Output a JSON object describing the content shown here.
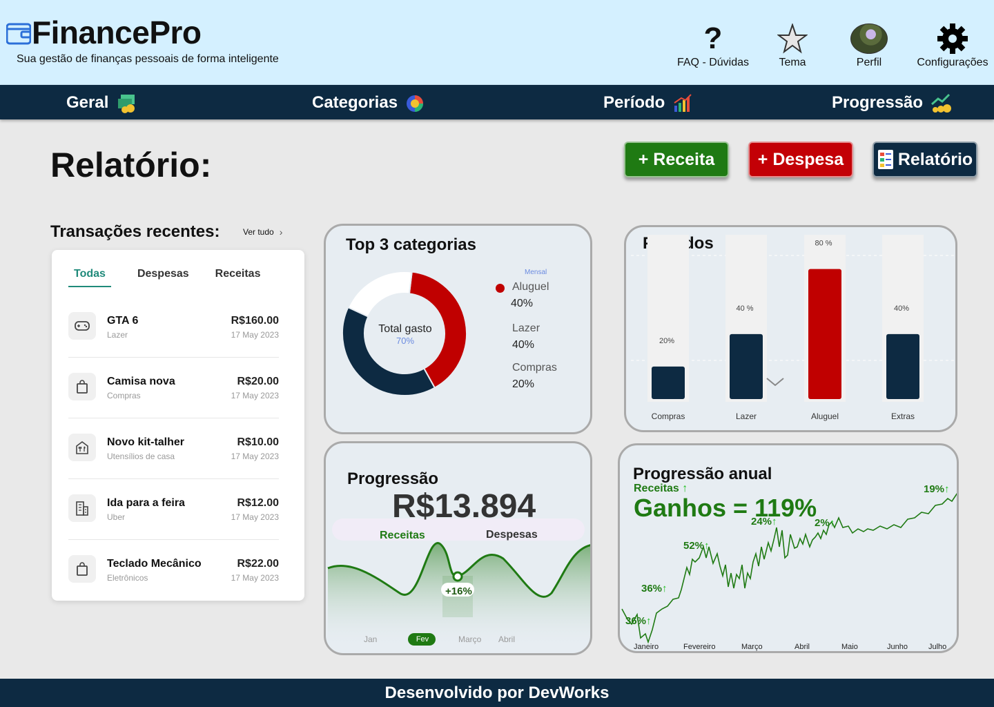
{
  "app": {
    "title": "FinancePro",
    "subtitle": "Sua gestão de finanças pessoais de forma inteligente"
  },
  "header_menu": {
    "faq": "FAQ - Dúvidas",
    "theme": "Tema",
    "profile": "Perfil",
    "settings": "Configurações"
  },
  "nav": {
    "general": "Geral",
    "categories": "Categorias",
    "period": "Período",
    "progression": "Progressão"
  },
  "page": {
    "title": "Relatório:"
  },
  "actions": {
    "income": "+ Receita",
    "expense": "+ Despesa",
    "report": "Relatório"
  },
  "transactions": {
    "title": "Transações recentes:",
    "see_all": "Ver tudo",
    "tabs": [
      "Todas",
      "Despesas",
      "Receitas"
    ],
    "items": [
      {
        "name": "GTA 6",
        "category": "Lazer",
        "amount": "R$160.00",
        "date": "17 May 2023",
        "icon": "gamepad-icon"
      },
      {
        "name": "Camisa nova",
        "category": "Compras",
        "amount": "R$20.00",
        "date": "17 May 2023",
        "icon": "shopping-bag-icon"
      },
      {
        "name": "Novo kit-talher",
        "category": "Utensílios de casa",
        "amount": "R$10.00",
        "date": "17 May 2023",
        "icon": "cutlery-icon"
      },
      {
        "name": "Ida para a feira",
        "category": "Uber",
        "amount": "R$12.00",
        "date": "17 May 2023",
        "icon": "building-icon"
      },
      {
        "name": "Teclado Mecânico",
        "category": "Eletrônicos",
        "amount": "R$22.00",
        "date": "17 May 2023",
        "icon": "shopping-bag-icon"
      }
    ]
  },
  "top_categories": {
    "title": "Top 3 categorias",
    "center_label": "Total gasto",
    "center_value": "70%",
    "period_label": "Mensal",
    "legend": [
      {
        "name": "Aluguel",
        "value": "40%"
      },
      {
        "name": "Lazer",
        "value": "40%"
      },
      {
        "name": "Compras",
        "value": "20%"
      }
    ],
    "colors": {
      "red": "#c00000",
      "dark": "#0d2a42",
      "white": "#ffffff"
    }
  },
  "chart_data": [
    {
      "type": "pie",
      "title": "Top 3 categorias",
      "categories": [
        "Aluguel",
        "Lazer",
        "Compras"
      ],
      "values": [
        40,
        40,
        20
      ]
    },
    {
      "type": "bar",
      "title": "Períodos",
      "categories": [
        "Compras",
        "Lazer",
        "Aluguel",
        "Extras"
      ],
      "values": [
        20,
        40,
        80,
        40
      ],
      "value_labels": [
        "20%",
        "40 %",
        "80 %",
        "40%"
      ],
      "ylim": [
        0,
        100
      ]
    },
    {
      "type": "area",
      "title": "Progressão",
      "categories": [
        "Jan",
        "Fev",
        "Março",
        "Abril"
      ],
      "selected": "Fev",
      "annotation": "+16%"
    },
    {
      "type": "line",
      "title": "Progressão anual",
      "categories": [
        "Janeiro",
        "Fevereiro",
        "Março",
        "Abril",
        "Maio",
        "Junho",
        "Julho"
      ],
      "annotations": [
        "36%",
        "36%",
        "52%",
        "24%",
        "2%",
        "19%"
      ]
    }
  ],
  "periods": {
    "title": "Períodos",
    "bars": [
      {
        "label": "Compras",
        "value_label": "20%",
        "color": "#0d2a42"
      },
      {
        "label": "Lazer",
        "value_label": "40 %",
        "color": "#0d2a42"
      },
      {
        "label": "Aluguel",
        "value_label": "80 %",
        "color": "#c00000"
      },
      {
        "label": "Extras",
        "value_label": "40%",
        "color": "#0d2a42"
      }
    ]
  },
  "progression": {
    "title": "Progressão",
    "amount": "R$13.894",
    "income_label": "Receitas",
    "expense_label": "Despesas",
    "badge": "+16%",
    "months": [
      "Jan",
      "Fev",
      "Março",
      "Abril"
    ]
  },
  "annual": {
    "title": "Progressão anual",
    "subtitle": "Receitas",
    "headline": "Ganhos = 119%",
    "markers": [
      "36%",
      "36%",
      "52%",
      "24%",
      "2%",
      "19%"
    ],
    "months": [
      "Janeiro",
      "Fevereiro",
      "Março",
      "Abril",
      "Maio",
      "Junho",
      "Julho"
    ]
  },
  "footer": {
    "text": "Desenvolvido por DevWorks"
  }
}
